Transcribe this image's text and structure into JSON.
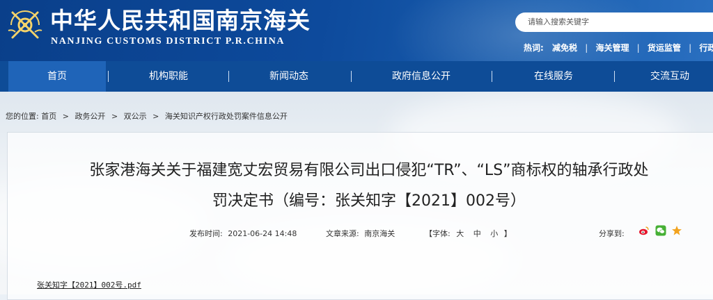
{
  "header": {
    "title": "中华人民共和国南京海关",
    "subtitle": "NANJING CUSTOMS DISTRICT P.R.CHINA",
    "search_placeholder": "请输入搜索关键字",
    "hot_label": "热词:",
    "hot_words": [
      "减免税",
      "海关管理",
      "货运监管",
      "行政审"
    ]
  },
  "nav": {
    "items": [
      "首页",
      "机构职能",
      "新闻动态",
      "政府信息公开",
      "在线服务",
      "交流互动"
    ],
    "active_index": 0
  },
  "breadcrumb": {
    "label": "您的位置:",
    "items": [
      "首页",
      "政务公开",
      "双公示",
      "海关知识产权行政处罚案件信息公开"
    ]
  },
  "article": {
    "title_line1": "张家港海关关于福建宽丈宏贸易有限公司出口侵犯“TR”、“LS”商标权的轴承行政处",
    "title_line2": "罚决定书（编号：张关知字【2021】002号）",
    "publish_label": "发布时间:",
    "publish_time": "2021-06-24 14:48",
    "source_label": "文章来源:",
    "source": "南京海关",
    "font_label": "【字体:",
    "font_large": "大",
    "font_medium": "中",
    "font_small": "小",
    "font_close": "】",
    "share_label": "分享到:",
    "attachment": "张关知字【2021】002号.pdf"
  },
  "colors": {
    "header_blue": "#0a3f8a",
    "nav_blue": "#0e4c97",
    "nav_active": "#1f64b8",
    "weibo_red": "#e6162d",
    "wechat_green": "#46b035",
    "star_orange": "#f2a31f"
  },
  "icons": [
    "customs-emblem-icon",
    "weibo-icon",
    "wechat-icon",
    "favorite-star-icon"
  ]
}
